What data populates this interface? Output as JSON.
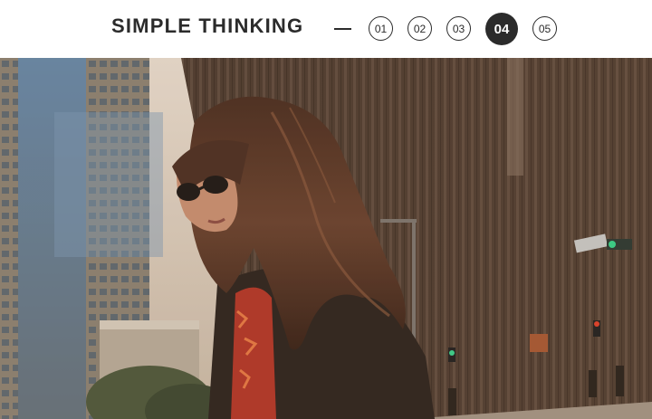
{
  "header": {
    "title": "SIMPLE THINKING",
    "pages": [
      "01",
      "02",
      "03",
      "04",
      "05"
    ],
    "active_page": "04"
  },
  "colors": {
    "text": "#2b2b2b",
    "active_bg": "#2b2b2b",
    "active_text": "#ffffff"
  },
  "photo": {
    "icon": "hero-photo-woman-city"
  }
}
